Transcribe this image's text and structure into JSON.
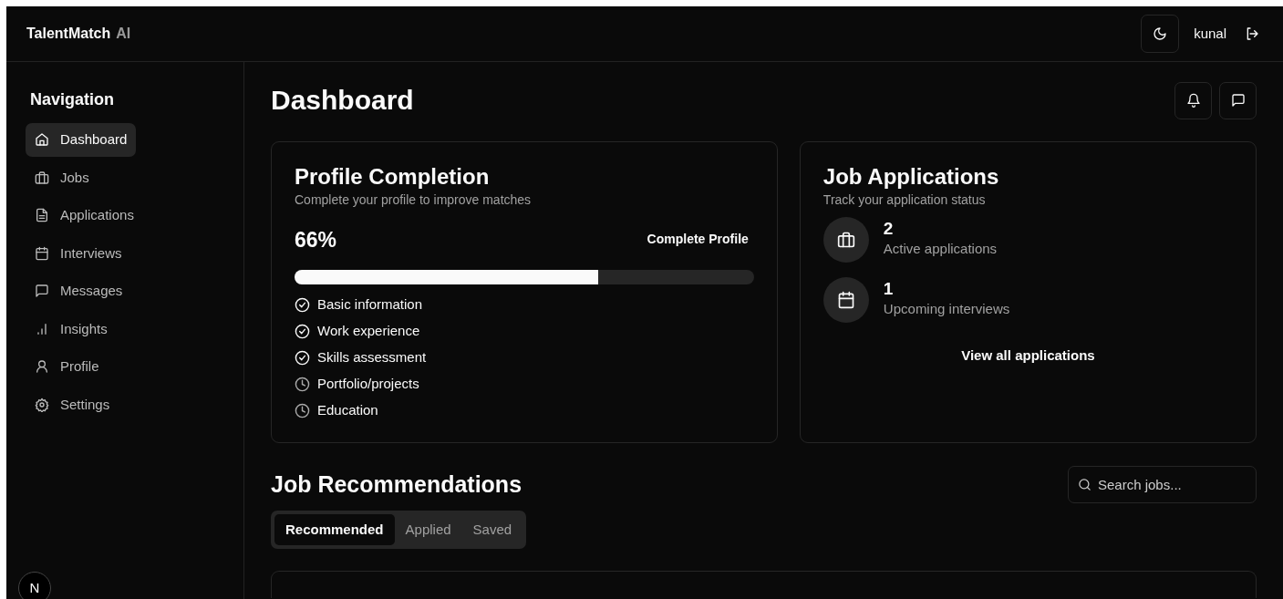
{
  "header": {
    "brand": "TalentMatch",
    "brand_suffix": "AI",
    "user": "kunal"
  },
  "sidebar": {
    "title": "Navigation",
    "items": [
      {
        "label": "Dashboard",
        "selected": true
      },
      {
        "label": "Jobs",
        "selected": false
      },
      {
        "label": "Applications",
        "selected": false
      },
      {
        "label": "Interviews",
        "selected": false
      },
      {
        "label": "Messages",
        "selected": false
      },
      {
        "label": "Insights",
        "selected": false
      },
      {
        "label": "Profile",
        "selected": false
      },
      {
        "label": "Settings",
        "selected": false
      }
    ]
  },
  "page_title": "Dashboard",
  "profile_card": {
    "title": "Profile Completion",
    "subtitle": "Complete your profile to improve matches",
    "percent": "66%",
    "level": 0.66,
    "action": "Complete Profile",
    "steps": [
      {
        "label": "Basic information",
        "done": true
      },
      {
        "label": "Work experience",
        "done": true
      },
      {
        "label": "Skills assessment",
        "done": true
      },
      {
        "label": "Portfolio/projects",
        "done": false
      },
      {
        "label": "Education",
        "done": false
      }
    ]
  },
  "applications_card": {
    "title": "Job Applications",
    "subtitle": "Track your application status",
    "stats": [
      {
        "value": "2",
        "label": "Active applications"
      },
      {
        "value": "1",
        "label": "Upcoming interviews"
      }
    ],
    "action": "View all applications"
  },
  "recommendations": {
    "title": "Job Recommendations",
    "search": {
      "placeholder": "Search jobs..."
    },
    "tabs": [
      {
        "label": "Recommended",
        "selected": true
      },
      {
        "label": "Applied",
        "selected": false
      },
      {
        "label": "Saved",
        "selected": false
      }
    ]
  },
  "dev_badge": "N"
}
